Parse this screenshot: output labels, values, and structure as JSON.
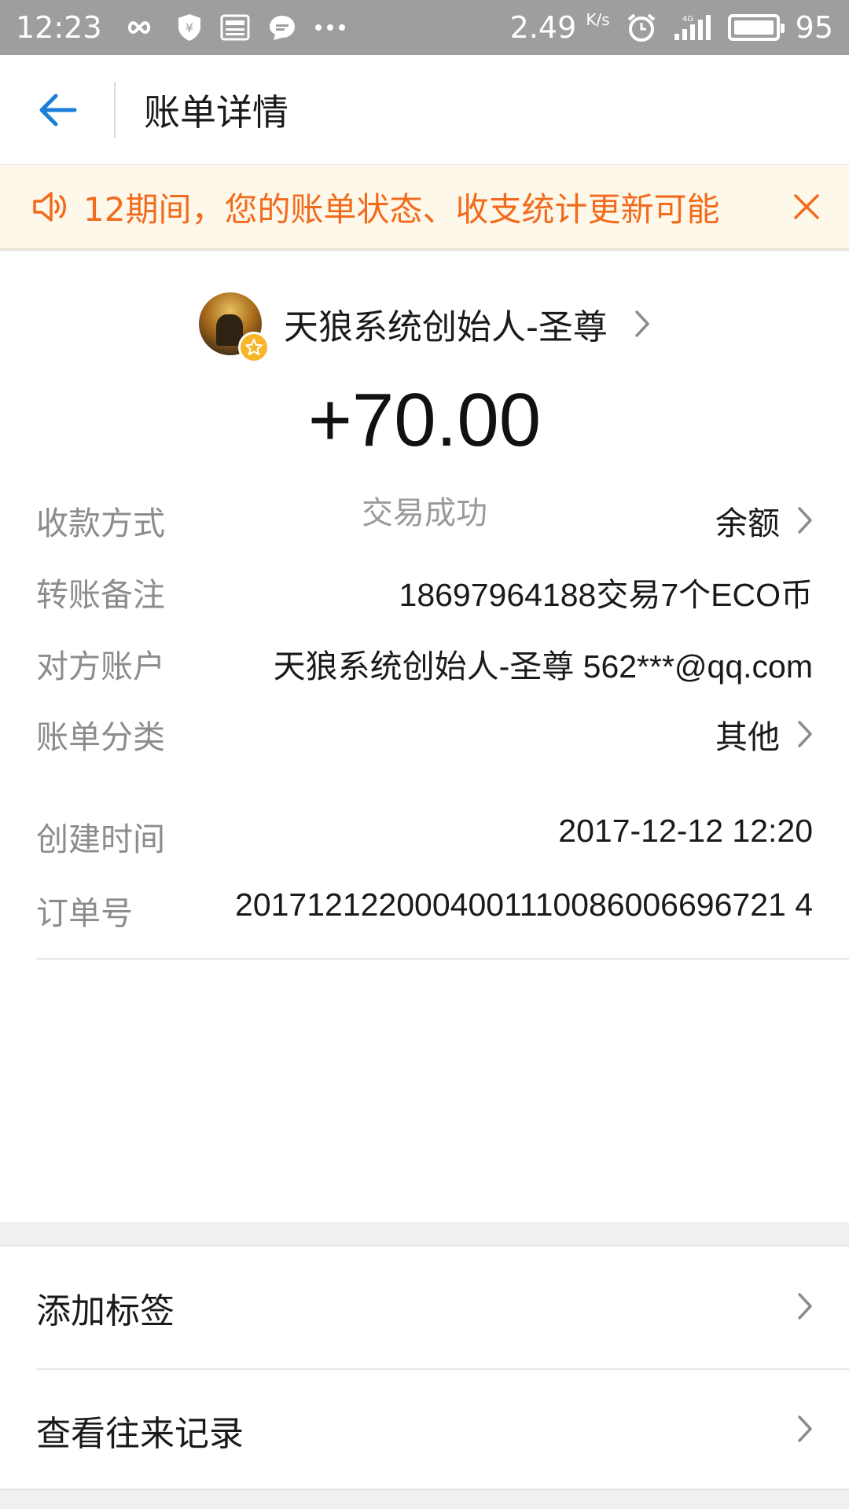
{
  "status_bar": {
    "time": "12:23",
    "net_speed": "2.49",
    "net_speed_unit": "K/s",
    "battery": "95",
    "icons": [
      "infinity-icon",
      "shield-yen-icon",
      "news-icon",
      "chat-bubble-icon",
      "more-dots-icon",
      "alarm-icon",
      "signal-4g-icon",
      "battery-icon"
    ]
  },
  "header": {
    "title": "账单详情",
    "back_icon": "back-arrow-icon"
  },
  "notice": {
    "text": "12期间，您的账单状态、收支统计更新可能",
    "icon": "speaker-icon",
    "close_icon": "close-icon",
    "colors": {
      "text": "#f26b1d",
      "background": "#fdf8e9"
    }
  },
  "payee": {
    "name": "天狼系统创始人-圣尊"
  },
  "amount": "+70.00",
  "status": "交易成功",
  "details": {
    "payment_method": {
      "label": "收款方式",
      "value": "余额"
    },
    "remark": {
      "label": "转账备注",
      "value": "18697964188交易7个ECO币"
    },
    "counterparty": {
      "label": "对方账户",
      "value": "天狼系统创始人-圣尊 562***@qq.com"
    },
    "category": {
      "label": "账单分类",
      "value": "其他"
    },
    "created_time": {
      "label": "创建时间",
      "value": "2017-12-12 12:20"
    },
    "order_no": {
      "label": "订单号",
      "value": "2017121220004001110086006696721 4"
    }
  },
  "actions": [
    {
      "label": "添加标签"
    },
    {
      "label": "查看往来记录"
    }
  ],
  "accent_color": "#1a7fd8"
}
